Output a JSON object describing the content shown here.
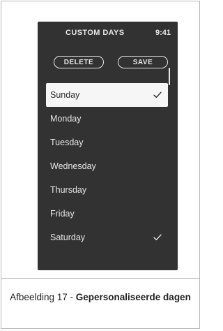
{
  "screen": {
    "title": "CUSTOM DAYS",
    "time": "9:41"
  },
  "buttons": {
    "delete_label": "DELETE",
    "save_label": "SAVE"
  },
  "days": [
    {
      "label": "Sunday",
      "selected": true,
      "checked": true
    },
    {
      "label": "Monday",
      "selected": false,
      "checked": false
    },
    {
      "label": "Tuesday",
      "selected": false,
      "checked": false
    },
    {
      "label": "Wednesday",
      "selected": false,
      "checked": false
    },
    {
      "label": "Thursday",
      "selected": false,
      "checked": false
    },
    {
      "label": "Friday",
      "selected": false,
      "checked": false
    },
    {
      "label": "Saturday",
      "selected": false,
      "checked": true
    }
  ],
  "caption": {
    "prefix": "Afbeelding 17 - ",
    "bold": "Gepersonaliseerde dagen"
  },
  "icons": {
    "check": "checkmark-icon"
  },
  "colors": {
    "screen_bg": "#323232",
    "text_light": "#e6e6e6",
    "selected_bg": "#f6f6f6"
  }
}
